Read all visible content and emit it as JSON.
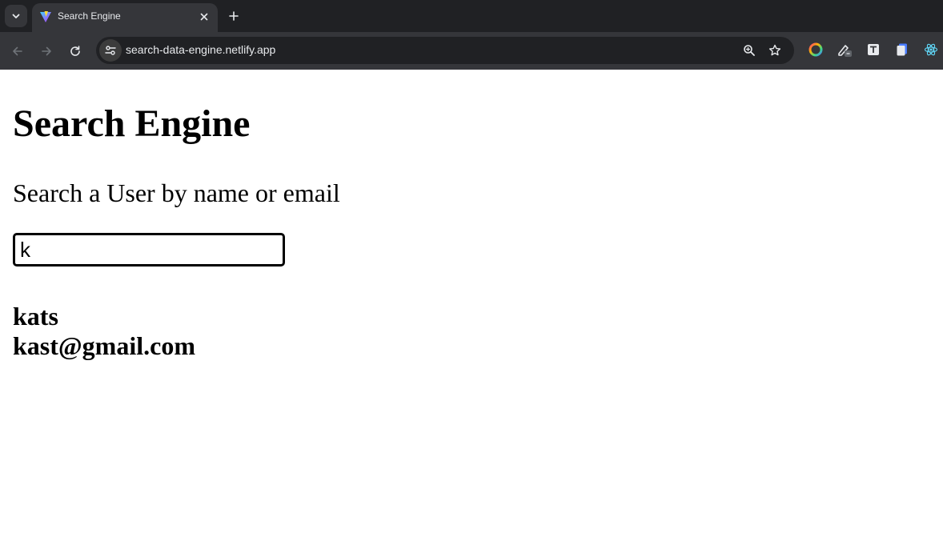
{
  "browser": {
    "tab": {
      "title": "Search Engine"
    },
    "address_bar": {
      "url": "search-data-engine.netlify.app"
    }
  },
  "page": {
    "title": "Search Engine",
    "subtitle": "Search a User by name or email",
    "search": {
      "value": "k"
    },
    "results": [
      {
        "name": "kats",
        "email": "kast@gmail.com"
      }
    ]
  }
}
